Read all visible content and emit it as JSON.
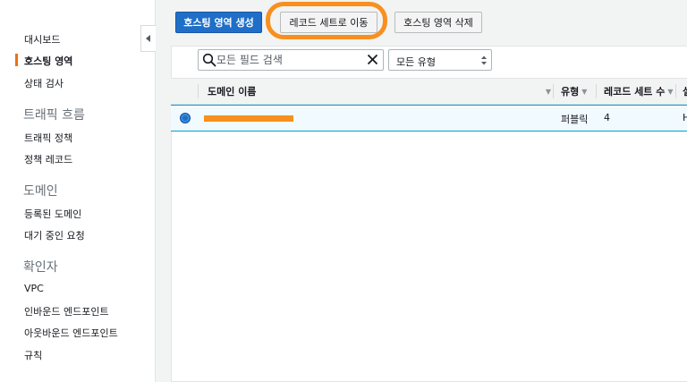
{
  "sidebar": {
    "items": [
      {
        "label": "대시보드"
      },
      {
        "label": "호스팅 영역"
      },
      {
        "label": "상태 검사"
      },
      {
        "label": "트래픽 정책"
      },
      {
        "label": "정책 레코드"
      },
      {
        "label": "등록된 도메인"
      },
      {
        "label": "대기 중인 요청"
      },
      {
        "label": "VPC"
      },
      {
        "label": "인바운드 엔드포인트"
      },
      {
        "label": "아웃바운드 엔드포인트"
      },
      {
        "label": "규칙"
      }
    ],
    "sections": [
      {
        "label": "트래픽 흐름"
      },
      {
        "label": "도메인"
      },
      {
        "label": "확인자"
      }
    ],
    "active_item": "호스팅 영역"
  },
  "toolbar": {
    "create_label": "호스팅 영역 생성",
    "goto_label": "레코드 세트로 이동",
    "delete_label": "호스팅 영역 삭제"
  },
  "filter": {
    "search_placeholder": "모든 필드 검색",
    "type_value": "모든 유형"
  },
  "table": {
    "columns": [
      {
        "label": "도메인 이름"
      },
      {
        "label": "유형"
      },
      {
        "label": "레코드 세트 수"
      },
      {
        "label": "설"
      }
    ],
    "rows": [
      {
        "domain": "",
        "type": "퍼블릭",
        "record_count": "4",
        "extra": "H"
      }
    ]
  },
  "colors": {
    "primary": "#1f6fc8",
    "highlight": "#f7901e",
    "active_indicator": "#ec7211"
  }
}
